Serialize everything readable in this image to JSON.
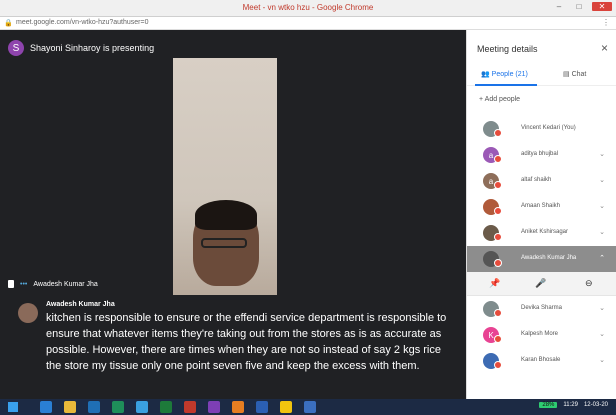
{
  "window": {
    "title": "Meet - vn wtko hzu - Google Chrome",
    "url": "meet.google.com/vn-wtko-hzu?authuser=0",
    "controls": [
      "–",
      "□",
      "✕"
    ]
  },
  "presenter": {
    "avatar_letter": "S",
    "text": "Shayoni Sinharoy is presenting"
  },
  "stage": {
    "speaker_name": "Awadesh Kumar Jha"
  },
  "captions": {
    "speaker": "Awadesh Kumar Jha",
    "text": "kitchen is responsible to ensure or the effendi service department is responsible to ensure that whatever items they're taking out from the stores as is as accurate as possible. However, there are times when they are not so instead of say 2 kgs rice the store my tissue only one point seven five and keep the excess with them."
  },
  "sidebar": {
    "title": "Meeting details",
    "close": "×",
    "tab_people": "People (21)",
    "tab_chat": "Chat",
    "add_people": "Add people",
    "participants": [
      {
        "name": "Vincent Kedari (You)",
        "color": "#7f8c8d",
        "letter": ""
      },
      {
        "name": "aditya bhujbal",
        "color": "#9b59b6",
        "letter": "a"
      },
      {
        "name": "altaf shaikh",
        "color": "#8e6e5a",
        "letter": "a"
      },
      {
        "name": "Amaan Shaikh",
        "color": "#b05a3a",
        "letter": ""
      },
      {
        "name": "Aniket Kshirsagar",
        "color": "#6b5b4a",
        "letter": ""
      },
      {
        "name": "Awadesh Kumar Jha",
        "color": "#555555",
        "letter": ""
      },
      {
        "name": "Devika Sharma",
        "color": "#7f8c8d",
        "letter": ""
      },
      {
        "name": "Kalpesh More",
        "color": "#e84393",
        "letter": "K"
      },
      {
        "name": "Karan Bhosale",
        "color": "#3d6bb3",
        "letter": ""
      }
    ],
    "actions": [
      "📌",
      "🎤",
      "⊖"
    ]
  },
  "taskbar": {
    "battery": "28%",
    "time": "11:29",
    "date": "12-03-20"
  }
}
